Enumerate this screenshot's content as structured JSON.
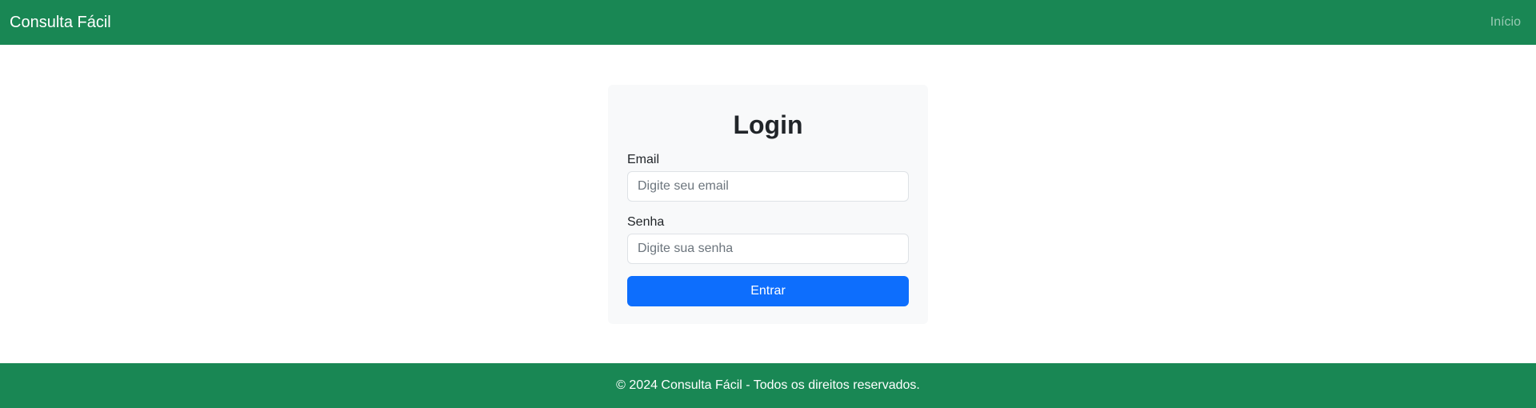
{
  "navbar": {
    "brand": "Consulta Fácil",
    "link_home": "Início",
    "color": "#198754"
  },
  "login": {
    "title": "Login",
    "email_label": "Email",
    "email_placeholder": "Digite seu email",
    "email_value": "",
    "password_label": "Senha",
    "password_placeholder": "Digite sua senha",
    "password_value": "",
    "submit_label": "Entrar",
    "submit_color": "#0d6efd"
  },
  "footer": {
    "text": "© 2024 Consulta Fácil - Todos os direitos reservados."
  }
}
